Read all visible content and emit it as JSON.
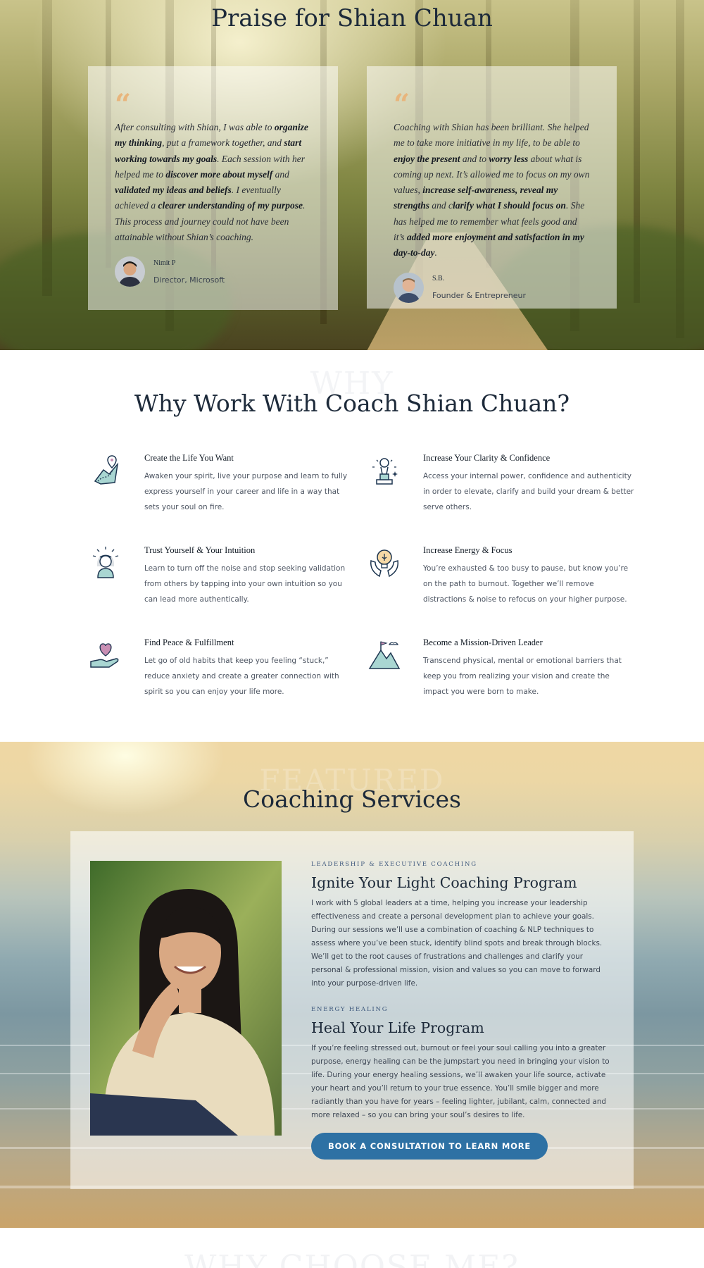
{
  "praise": {
    "title": "Praise for Shian Chuan",
    "testimonials": [
      {
        "quote_mark": "“",
        "name": "Nimit P",
        "role": "Director, Microsoft",
        "segments": [
          {
            "t": "After consulting with Shian, I was able to ",
            "b": false
          },
          {
            "t": "organize my thinking",
            "b": true
          },
          {
            "t": ", put a framework together, and ",
            "b": false
          },
          {
            "t": "start working towards my goals",
            "b": true
          },
          {
            "t": ". Each session with her helped me to ",
            "b": false
          },
          {
            "t": "discover more about myself",
            "b": true
          },
          {
            "t": " and ",
            "b": false
          },
          {
            "t": "validated my ideas and beliefs",
            "b": true
          },
          {
            "t": ". I eventually achieved a ",
            "b": false
          },
          {
            "t": "clearer understanding of my purpose",
            "b": true
          },
          {
            "t": ". This process and journey could not have been attainable without Shian’s coaching.",
            "b": false
          }
        ]
      },
      {
        "quote_mark": "“",
        "name": "S.B.",
        "role": "Founder & Entrepreneur",
        "segments": [
          {
            "t": "Coaching with Shian has been brilliant. She helped me to take more initiative in my life, to be able to ",
            "b": false
          },
          {
            "t": "enjoy the present",
            "b": true
          },
          {
            "t": " and to ",
            "b": false
          },
          {
            "t": "worry less",
            "b": true
          },
          {
            "t": " about what is coming up next. It’s allowed me to focus on my own values, ",
            "b": false
          },
          {
            "t": "increase self-awareness, reveal my strengths",
            "b": true
          },
          {
            "t": " and c",
            "b": false
          },
          {
            "t": "larify what I should focus on",
            "b": true
          },
          {
            "t": ". She has helped me to remember what feels good and it’s ",
            "b": false
          },
          {
            "t": "added more enjoyment and satisfaction in my day-to-day",
            "b": true
          },
          {
            "t": ".",
            "b": false
          }
        ]
      }
    ]
  },
  "why": {
    "ghost": "WHY",
    "title": "Why Work With Coach Shian Chuan?",
    "features": [
      {
        "icon": "map-path-icon",
        "title": "Create the Life You Want",
        "text": "Awaken your spirit, live your purpose and learn to fully express yourself in your career and life in a way that sets your soul on fire."
      },
      {
        "icon": "trophy-award-icon",
        "title": "Increase Your Clarity & Confidence",
        "text": "Access your internal power, confidence and authenticity in order to elevate, clarify and build your dream & better serve others."
      },
      {
        "icon": "meditating-woman-icon",
        "title": "Trust Yourself & Your Intuition",
        "text": "Learn to turn off the noise and stop seeking validation from others by tapping into your own intuition so you can lead more authentically."
      },
      {
        "icon": "lightbulb-hands-icon",
        "title": "Increase Energy & Focus",
        "text": "You’re exhausted & too busy to pause, but know you’re on the path to burnout. Together we’ll remove distractions & noise to refocus on your higher purpose."
      },
      {
        "icon": "heart-hand-icon",
        "title": "Find Peace & Fulfillment",
        "text": "Let go of old habits that keep you feeling “stuck,” reduce anxiety and create a greater connection with spirit so you can enjoy your life more."
      },
      {
        "icon": "mountain-flag-icon",
        "title": "Become a Mission-Driven Leader",
        "text": "Transcend physical, mental or emotional barriers that keep you from realizing your vision and create the impact you were born to make."
      }
    ]
  },
  "services": {
    "ghost": "FEATURED",
    "title": "Coaching Services",
    "programs": [
      {
        "eyebrow": "Leadership & Executive Coaching",
        "title": "Ignite Your Light Coaching Program",
        "text": "I work with 5 global leaders at a time, helping you increase your leadership effectiveness and create a personal development plan to achieve your goals. During our sessions we’ll use a combination of coaching & NLP techniques to assess where you’ve been stuck, identify blind spots and break through blocks. We’ll get to the root causes of frustrations and challenges and clarify your personal & professional mission, vision and values so you can move to forward into your purpose-driven life."
      },
      {
        "eyebrow": "Energy Healing",
        "title": "Heal Your Life Program",
        "text": "If you’re feeling stressed out, burnout or feel your soul calling you into a greater purpose, energy healing can be the jumpstart you need in bringing your vision to life. During your energy healing sessions, we’ll awaken your life source, activate your heart and you’ll return to your true essence. You’ll smile bigger and more radiantly than you have for years – feeling lighter, jubilant, calm, connected and more relaxed – so you can bring your soul’s desires to life."
      }
    ],
    "cta_label": "Book a consultation to learn more"
  },
  "next_ghost": "WHY CHOOSE ME?",
  "colors": {
    "navy": "#1d2a3a",
    "accent_blue": "#2e71a4",
    "quote_orange": "#e8b57c",
    "icon_teal": "#a9d6d2",
    "icon_pink": "#c98fb4"
  }
}
